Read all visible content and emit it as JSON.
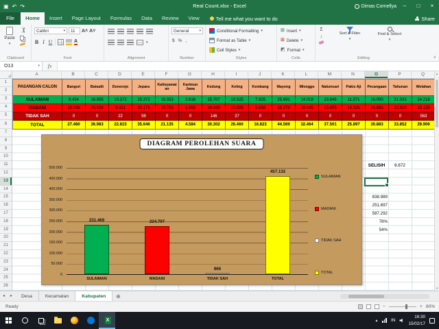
{
  "window": {
    "title": "Real Count.xlsx - Excel",
    "user": "Dimas Cornellya"
  },
  "icons": {
    "save": "▣",
    "undo": "↶",
    "redo": "↷",
    "qat_more": "▾",
    "minimize": "–",
    "restore": "□",
    "close": "×",
    "dropdown": "▾",
    "select_all": "◢",
    "new_sheet": "⊕",
    "sheet_nav_left": "◄",
    "sheet_nav_right": "►",
    "autosum": "Σ",
    "fill": "↓",
    "collapse_ribbon": "∧",
    "scroll_up": "▲",
    "scroll_down": "▼",
    "tray_up": "▲"
  },
  "ribbon": {
    "file_tab": "File",
    "tabs": [
      "Home",
      "Insert",
      "Page Layout",
      "Formulas",
      "Data",
      "Review",
      "View"
    ],
    "active_tab": "Home",
    "tell_me": "Tell me what you want to do",
    "share_label": "Share",
    "groups": [
      "Clipboard",
      "Font",
      "Alignment",
      "Number",
      "Styles",
      "Cells",
      "Editing"
    ],
    "paste_label": "Paste",
    "font_name": "Calibri",
    "font_size": "11",
    "font_buttons": [
      "B",
      "I",
      "U"
    ],
    "number_format": "General",
    "number_buttons": [
      "$",
      "%",
      ","
    ],
    "styles_buttons": [
      "Conditional Formatting",
      "Format as Table",
      "Cell Styles"
    ],
    "cells_buttons": [
      "Insert",
      "Delete",
      "Format"
    ],
    "editing_buttons": [
      "Sort & Filter",
      "Find & Select"
    ]
  },
  "formula_bar": {
    "name_box": "O13",
    "fx": "fx"
  },
  "sheet": {
    "selected_cell": "O13",
    "columns": [
      "A",
      "B",
      "C",
      "D",
      "E",
      "F",
      "G",
      "H",
      "I",
      "J",
      "K",
      "L",
      "M",
      "N",
      "O",
      "P",
      "Q"
    ],
    "row_count": 26,
    "table": {
      "corner": "PASANGAN CALON",
      "districts": [
        "Bangsri",
        "Batealit",
        "Donorojo",
        "Jepara",
        "Kalinyamatan",
        "Karimun Jawa",
        "Kedung",
        "Keling",
        "Kembang",
        "Mayong",
        "Mlonggo",
        "Nalumsari",
        "Pakis Aji",
        "Pecangaan",
        "Tahunan",
        "Welahan"
      ],
      "rows": [
        {
          "label": "SULAIMAN",
          "bg": "#00B050",
          "fg": "#000000",
          "values": [
            "9.434",
            "16.955",
            "13.372",
            "15.372",
            "10.353",
            "2.616",
            "15.707",
            "13.525",
            "7.925",
            "25.691",
            "14.019",
            "23.846",
            "11.571",
            "16.000",
            "21.033",
            "14.218"
          ]
        },
        {
          "label": "MADANI",
          "bg": "#FF0000",
          "fg": "#000000",
          "values": [
            "18.046",
            "20.028",
            "9.421",
            "20.176",
            "10.782",
            "1.968",
            "14.449",
            "12.898",
            "8.898",
            "18.878",
            "18.445",
            "13.655",
            "14.326",
            "14.883",
            "12.819",
            "15.125"
          ]
        },
        {
          "label": "TIDAK SAH",
          "bg": "#C00000",
          "fg": "#FFFFFF",
          "values": [
            "0",
            "0",
            "22",
            "98",
            "0",
            "0",
            "146",
            "37",
            "0",
            "0",
            "0",
            "0",
            "0",
            "0",
            "0",
            "563"
          ]
        },
        {
          "label": "TOTAL",
          "bg": "#FFFF00",
          "fg": "#000000",
          "values": [
            "27.480",
            "36.983",
            "22.815",
            "35.646",
            "21.135",
            "4.584",
            "30.302",
            "26.460",
            "16.823",
            "44.569",
            "32.464",
            "37.501",
            "25.897",
            "30.883",
            "33.852",
            "29.906"
          ]
        }
      ]
    },
    "side": {
      "selisih_label": "SELISIH",
      "selisih_value": "6.672",
      "numbers": [
        "838.989",
        "251.697",
        "587.292"
      ],
      "percents": [
        "78%",
        "54%"
      ]
    }
  },
  "chart_data": {
    "type": "bar",
    "title": "DIAGRAM PEROLEHAN SUARA",
    "categories": [
      "SULAIMAN",
      "MADANI",
      "TIDAK SAH",
      "TOTAL"
    ],
    "values": [
      231469,
      224797,
      866,
      457132
    ],
    "value_labels": [
      "231.469",
      "224.797",
      "866",
      "457.132"
    ],
    "bar_colors": [
      "#00B050",
      "#FF0000",
      "#FFFFFF",
      "#FFFF00"
    ],
    "ylim": [
      0,
      500000
    ],
    "ytick_step": 50000,
    "ytick_labels": [
      "0",
      "50.000",
      "100.000",
      "150.000",
      "200.000",
      "250.000",
      "300.000",
      "350.000",
      "400.000",
      "450.000",
      "500.000"
    ],
    "legend": [
      "SULAIMAN",
      "MADANI",
      "TIDAK SAH",
      "TOTAL"
    ],
    "legend_position": "right",
    "gridlines": true,
    "background_color": "#C49A5E"
  },
  "sheet_tabs": {
    "items": [
      "Desa",
      "Kecamatan",
      "Kabupaten"
    ],
    "active": "Kabupaten"
  },
  "status_bar": {
    "mode": "Ready",
    "zoom": "80%"
  },
  "taskbar": {
    "lang": "IN",
    "time": "16:30",
    "date": "15/02/17"
  }
}
